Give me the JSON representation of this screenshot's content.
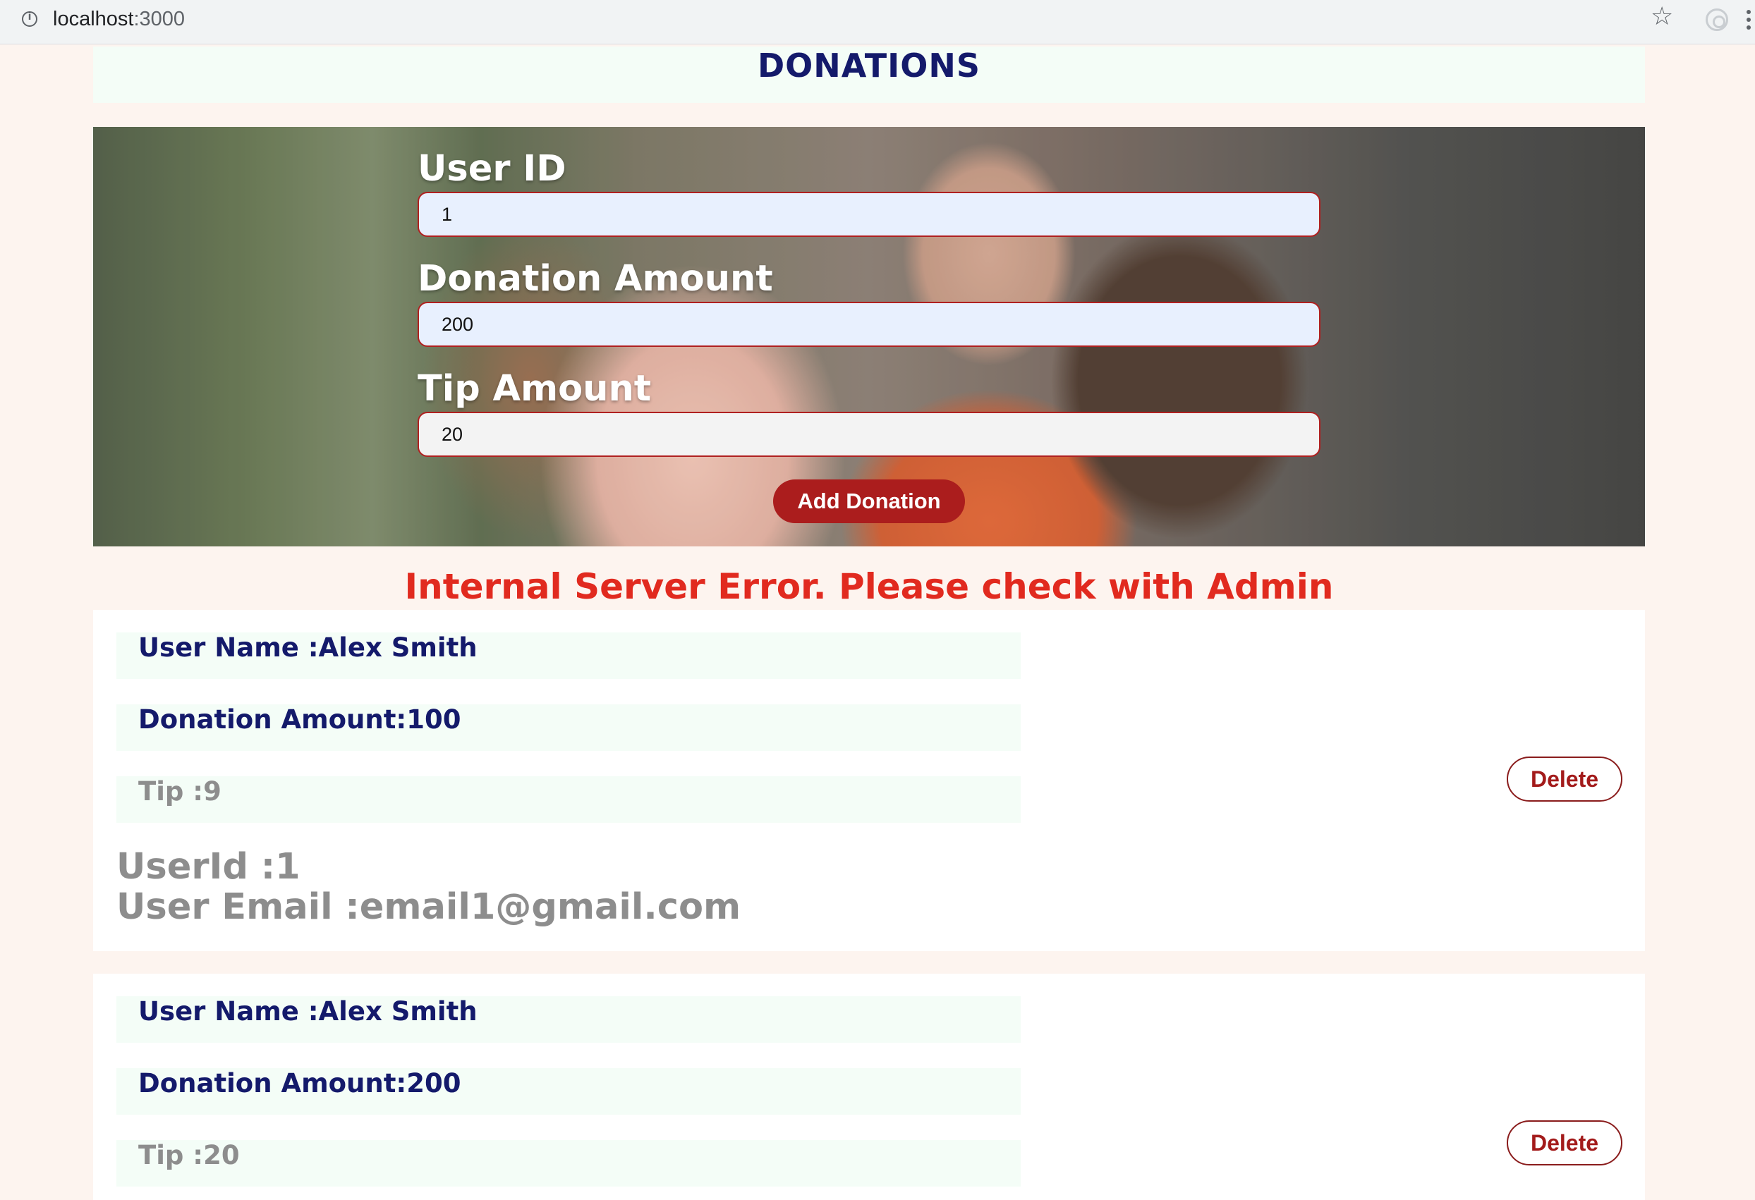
{
  "browser": {
    "url_host": "localhost",
    "url_port": ":3000"
  },
  "header": {
    "title": "DONATIONS"
  },
  "form": {
    "user_id_label": "User ID",
    "user_id_value": "1",
    "donation_amount_label": "Donation Amount",
    "donation_amount_value": "200",
    "tip_amount_label": "Tip Amount",
    "tip_amount_value": "20",
    "submit_label": "Add Donation"
  },
  "error_message": "Internal Server Error. Please check with Admin",
  "donations": [
    {
      "user_name": "User Name :Alex Smith",
      "donation_amount": "Donation Amount:100",
      "tip": "Tip :9",
      "user_id": "UserId :1",
      "user_email": "User Email :email1@gmail.com",
      "delete_label": "Delete"
    },
    {
      "user_name": "User Name :Alex Smith",
      "donation_amount": "Donation Amount:200",
      "tip": "Tip :20",
      "delete_label": "Delete"
    }
  ]
}
